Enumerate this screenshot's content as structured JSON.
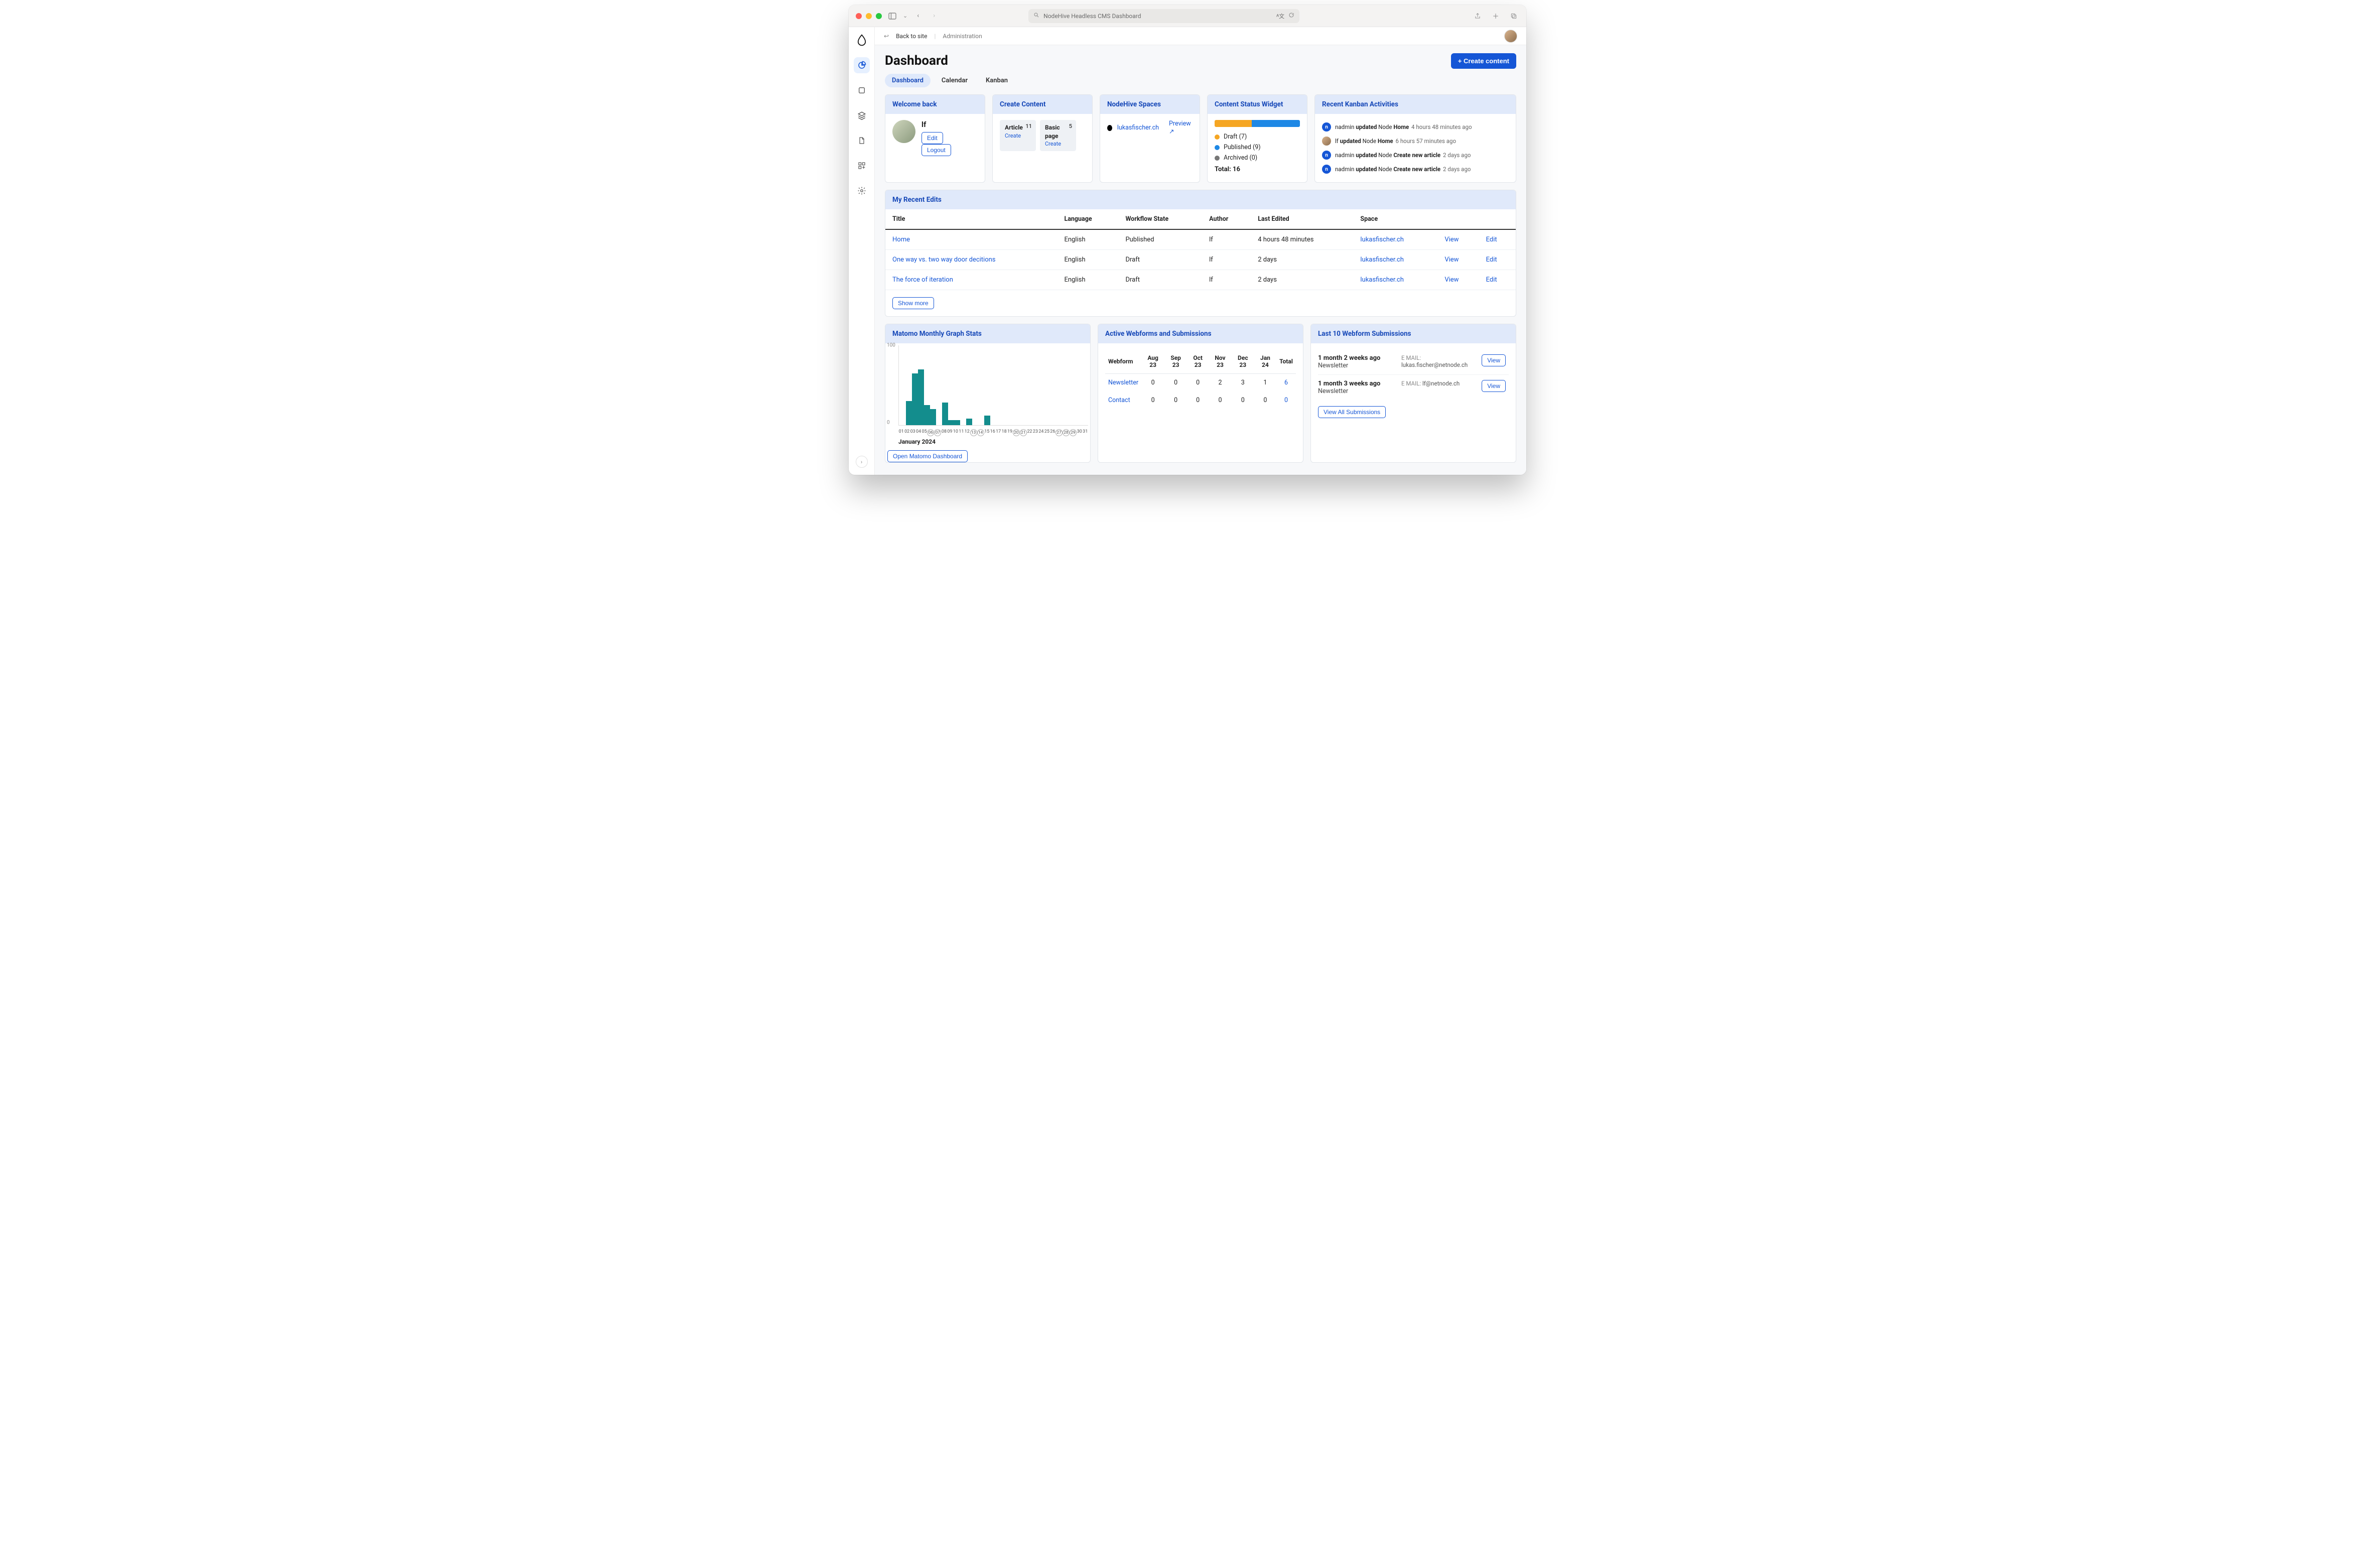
{
  "browser": {
    "address": "NodeHive Headless CMS Dashboard"
  },
  "topbar": {
    "back_to_site": "Back to site",
    "admin": "Administration"
  },
  "header": {
    "title": "Dashboard",
    "create_btn": "+ Create content"
  },
  "tabs": {
    "dashboard": "Dashboard",
    "calendar": "Calendar",
    "kanban": "Kanban"
  },
  "welcome": {
    "title": "Welcome back",
    "name": "lf",
    "edit": "Edit",
    "logout": "Logout"
  },
  "create_content": {
    "title": "Create Content",
    "article_label": "Article",
    "article_count": "11",
    "article_link": "Create",
    "basic_label": "Basic",
    "basic_sub": "page",
    "basic_count": "5",
    "basic_link": "Create"
  },
  "spaces": {
    "title": "NodeHive Spaces",
    "name": "lukasfischer.ch",
    "preview": "Preview ↗"
  },
  "status": {
    "title": "Content Status Widget",
    "draft_label": "Draft (7)",
    "published_label": "Published (9)",
    "archived_label": "Archived (0)",
    "total": "Total: 16",
    "draft_count": 7,
    "published_count": 9,
    "archived_count": 0
  },
  "kanban": {
    "title": "Recent Kanban Activities",
    "items": [
      {
        "user": "nadmin",
        "verb": "updated",
        "entity": "Node",
        "node": "Home",
        "time": "4 hours 48 minutes ago",
        "icon": "n"
      },
      {
        "user": "lf",
        "verb": "updated",
        "entity": "Node",
        "node": "Home",
        "time": "6 hours 57 minutes ago",
        "icon": "photo"
      },
      {
        "user": "nadmin",
        "verb": "updated",
        "entity": "Node",
        "node": "Create new article",
        "time": "2 days ago",
        "icon": "n"
      },
      {
        "user": "nadmin",
        "verb": "updated",
        "entity": "Node",
        "node": "Create new article",
        "time": "2 days ago",
        "icon": "n"
      }
    ]
  },
  "recent_edits": {
    "title": "My Recent Edits",
    "columns": {
      "title": "Title",
      "language": "Language",
      "workflow": "Workflow State",
      "author": "Author",
      "last_edited": "Last Edited",
      "space": "Space"
    },
    "rows": [
      {
        "title": "Home",
        "language": "English",
        "workflow": "Published",
        "author": "lf",
        "last_edited": "4 hours 48 minutes",
        "space": "lukasfischer.ch"
      },
      {
        "title": "One way vs. two way door decitions",
        "language": "English",
        "workflow": "Draft",
        "author": "lf",
        "last_edited": "2 days",
        "space": "lukasfischer.ch"
      },
      {
        "title": "The force of iteration",
        "language": "English",
        "workflow": "Draft",
        "author": "lf",
        "last_edited": "2 days",
        "space": "lukasfischer.ch"
      }
    ],
    "view": "View",
    "edit": "Edit",
    "show_more": "Show more"
  },
  "matomo": {
    "title": "Matomo Monthly Graph Stats",
    "open_btn": "Open Matomo Dashboard",
    "month_label": "January 2024"
  },
  "chart_data": {
    "type": "bar",
    "categories": [
      "01",
      "02",
      "03",
      "04",
      "05",
      "06",
      "07",
      "08",
      "09",
      "10",
      "11",
      "12",
      "13",
      "14",
      "15",
      "16",
      "17",
      "18",
      "19",
      "20",
      "21",
      "22",
      "23",
      "24",
      "25",
      "26",
      "27",
      "28",
      "29",
      "30",
      "31"
    ],
    "values": [
      0,
      30,
      65,
      70,
      25,
      20,
      0,
      28,
      6,
      6,
      0,
      8,
      0,
      0,
      12,
      0,
      0,
      0,
      0,
      0,
      0,
      0,
      0,
      0,
      0,
      0,
      0,
      0,
      0,
      0,
      0
    ],
    "ylabel": "",
    "ylim": [
      0,
      100
    ],
    "yticks": [
      0,
      100
    ],
    "circled_days": [
      6,
      7,
      13,
      14,
      20,
      21,
      27,
      28,
      29
    ]
  },
  "webforms": {
    "title": "Active Webforms and Submissions",
    "columns": [
      "Webform",
      "Aug 23",
      "Sep 23",
      "Oct 23",
      "Nov 23",
      "Dec 23",
      "Jan 24",
      "Total"
    ],
    "rows": [
      {
        "name": "Newsletter",
        "vals": [
          "0",
          "0",
          "0",
          "2",
          "3",
          "1"
        ],
        "total": "6"
      },
      {
        "name": "Contact",
        "vals": [
          "0",
          "0",
          "0",
          "0",
          "0",
          "0"
        ],
        "total": "0"
      }
    ]
  },
  "submissions": {
    "title": "Last 10 Webform Submissions",
    "view": "View",
    "view_all": "View All Submissions",
    "email_label": "E MAIL:",
    "rows": [
      {
        "when": "1 month 2 weeks ago",
        "form": "Newsletter",
        "email": "lukas.fischer@netnode.ch"
      },
      {
        "when": "1 month 3 weeks ago",
        "form": "Newsletter",
        "email": "lf@netnode.ch"
      }
    ]
  }
}
